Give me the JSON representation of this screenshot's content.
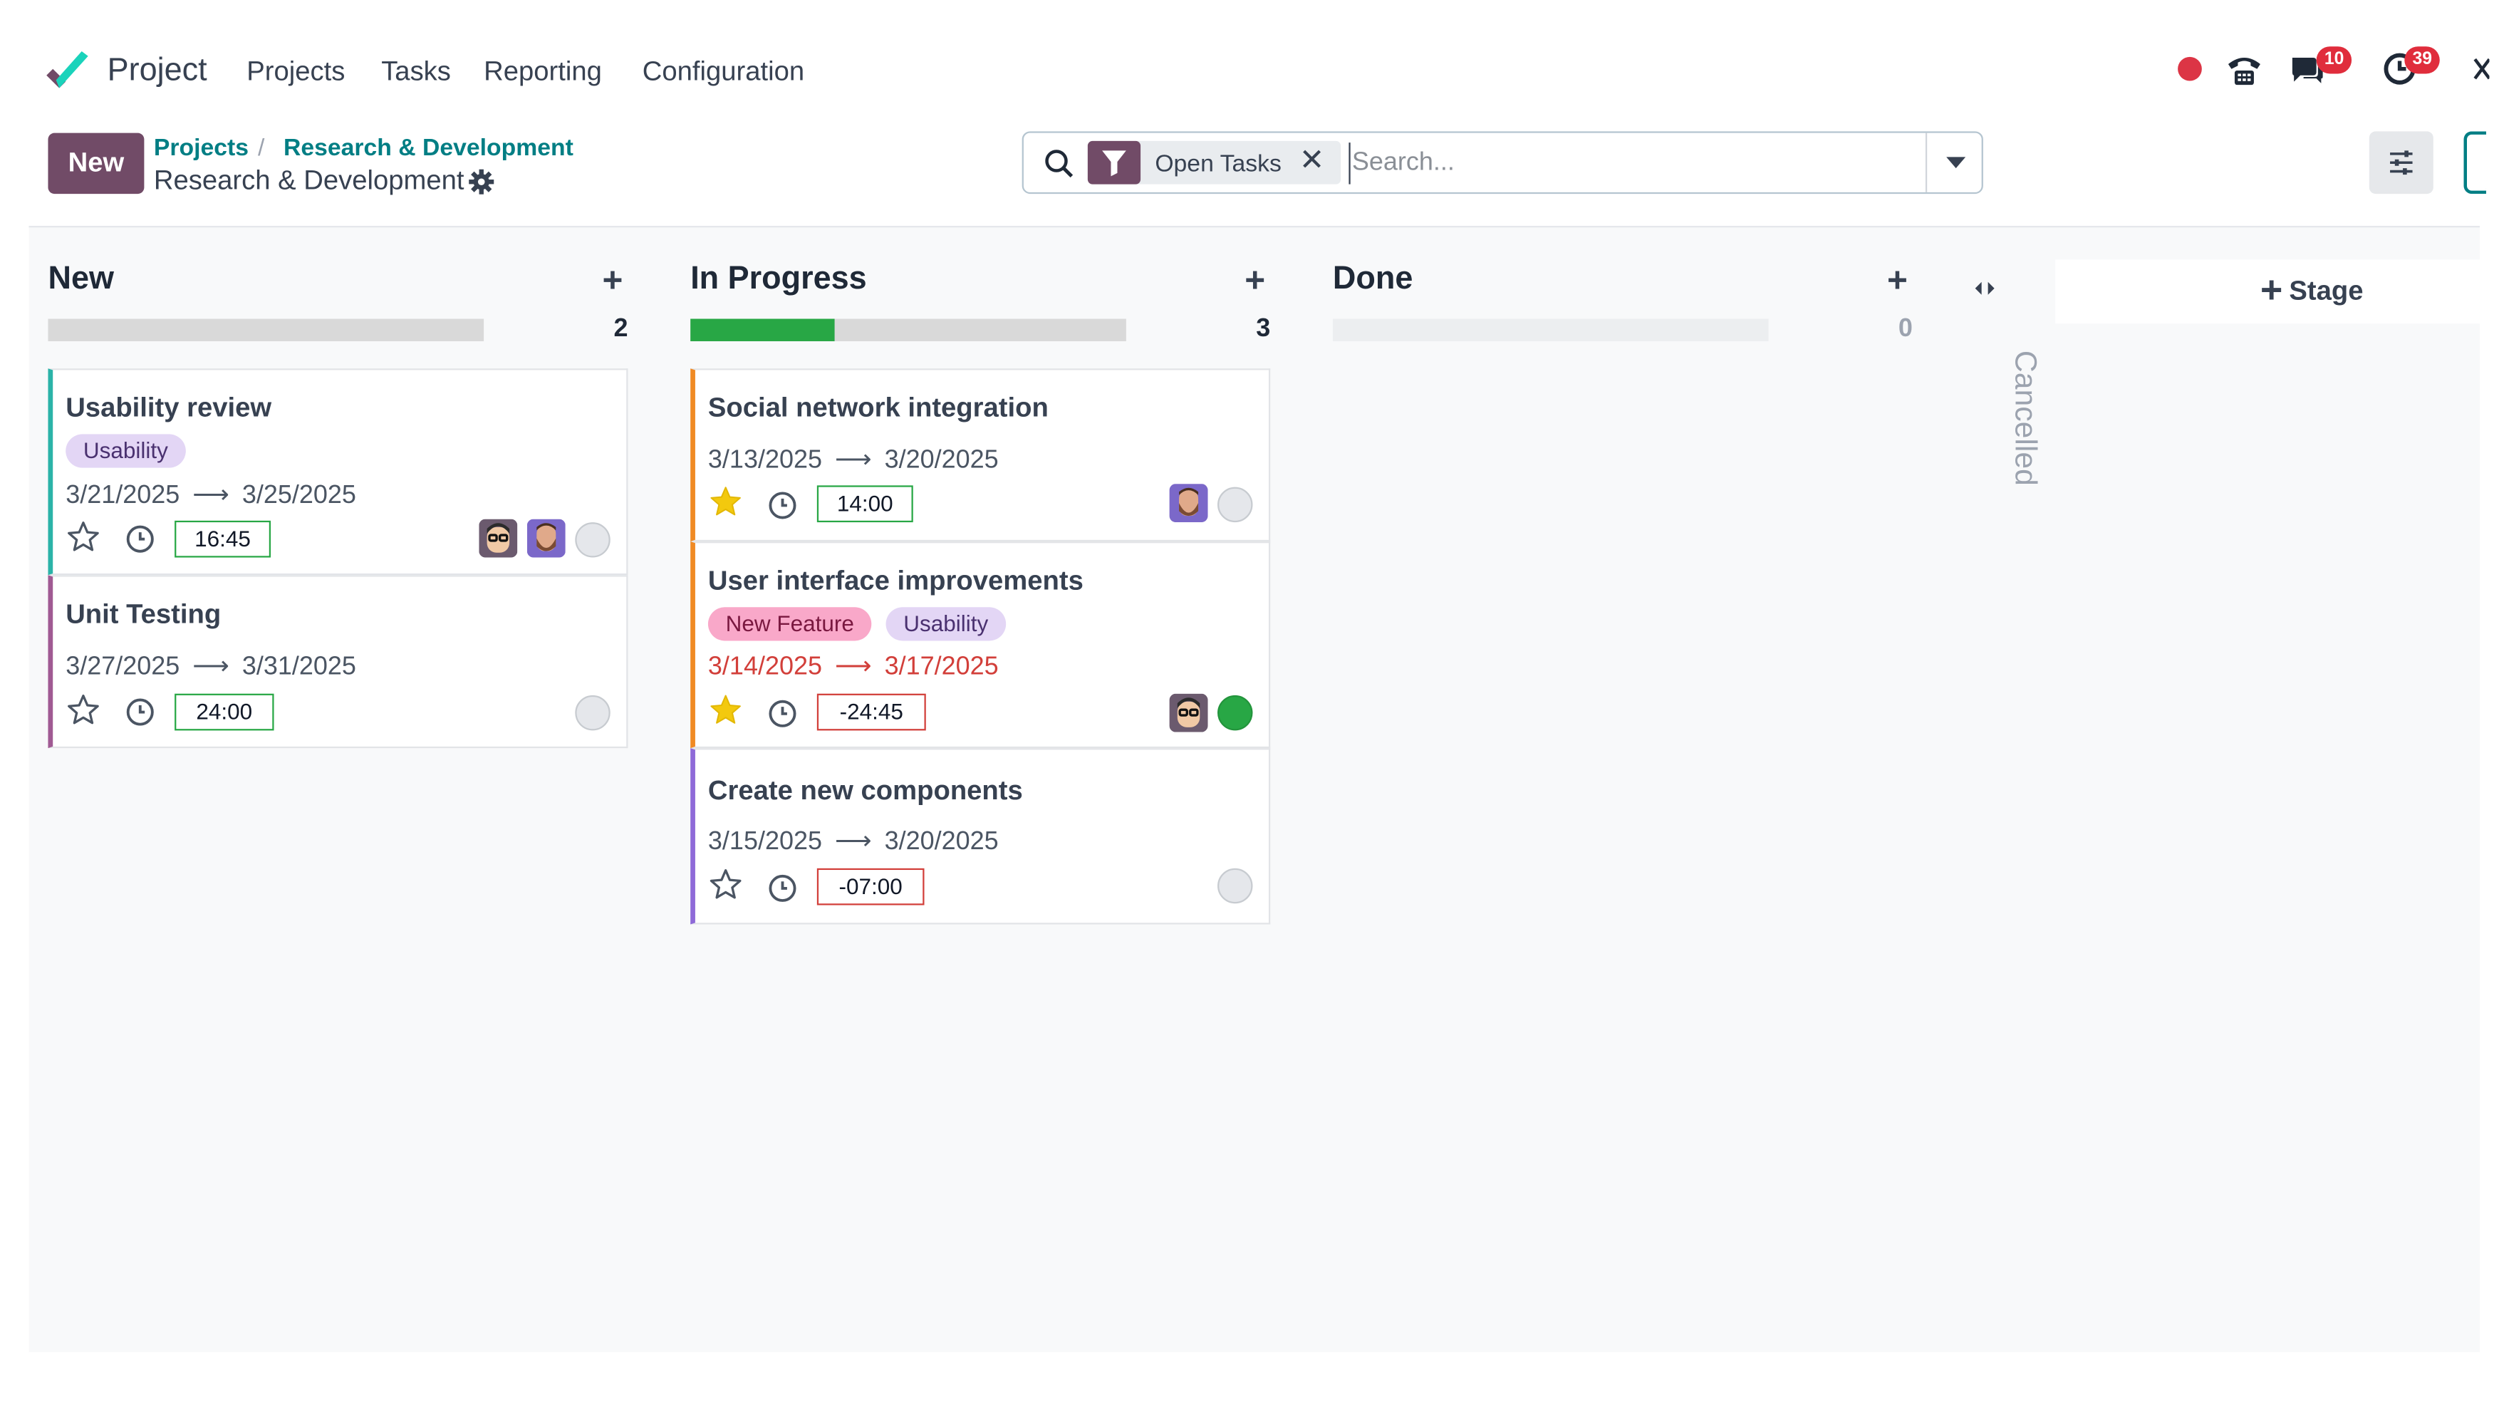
{
  "app": {
    "name": "Project"
  },
  "nav": {
    "projects": "Projects",
    "tasks": "Tasks",
    "reporting": "Reporting",
    "configuration": "Configuration"
  },
  "systray": {
    "messages_count": "10",
    "activities_count": "39"
  },
  "control": {
    "new_label": "New",
    "breadcrumb_root": "Projects",
    "breadcrumb_separator": "/",
    "breadcrumb_parent": "Research & Development",
    "current": "Research & Development"
  },
  "search": {
    "facet": "Open Tasks",
    "remove": "✕",
    "placeholder": "Search..."
  },
  "columns": [
    {
      "title": "New",
      "count": "2",
      "progress": 0
    },
    {
      "title": "In Progress",
      "count": "3",
      "progress": 0.33
    },
    {
      "title": "Done",
      "count": "0",
      "progress": 0
    }
  ],
  "folded_column": {
    "title": "Cancelled"
  },
  "add_stage_label": "Stage",
  "colors": {
    "accent": "#714b67",
    "link": "#017e84",
    "success": "#28a745",
    "danger": "#d23f3a",
    "tag_usability_bg": "#e3d6f5",
    "tag_new_feature_bg": "#f9a8c9",
    "star_filled": "#f3c90e"
  },
  "cards": {
    "usability_review": {
      "title": "Usability review",
      "tags": [
        "Usability"
      ],
      "start": "3/21/2025",
      "end": "3/25/2025",
      "hours": "16:45",
      "priority": false,
      "status": "normal"
    },
    "unit_testing": {
      "title": "Unit Testing",
      "start": "3/27/2025",
      "end": "3/31/2025",
      "hours": "24:00",
      "priority": false,
      "status": "normal"
    },
    "social_network": {
      "title": "Social network integration",
      "start": "3/13/2025",
      "end": "3/20/2025",
      "hours": "14:00",
      "priority": true,
      "status": "normal"
    },
    "ui_improvements": {
      "title": "User interface improvements",
      "tags": [
        "New Feature",
        "Usability"
      ],
      "start": "3/14/2025",
      "end": "3/17/2025",
      "hours": "-24:45",
      "priority": true,
      "status": "done"
    },
    "new_components": {
      "title": "Create new components",
      "start": "3/15/2025",
      "end": "3/20/2025",
      "hours": "-07:00",
      "priority": false,
      "status": "normal"
    }
  },
  "icons": {
    "logo": "odoo-project-logo",
    "search": "search-icon",
    "filter": "filter-icon",
    "gear": "gear-icon",
    "star_empty": "star-outline-icon",
    "star_filled": "star-filled-icon",
    "clock": "clock-icon",
    "plus": "plus-icon",
    "fold": "fold-arrows-icon",
    "settings_panel": "sliders-icon"
  }
}
